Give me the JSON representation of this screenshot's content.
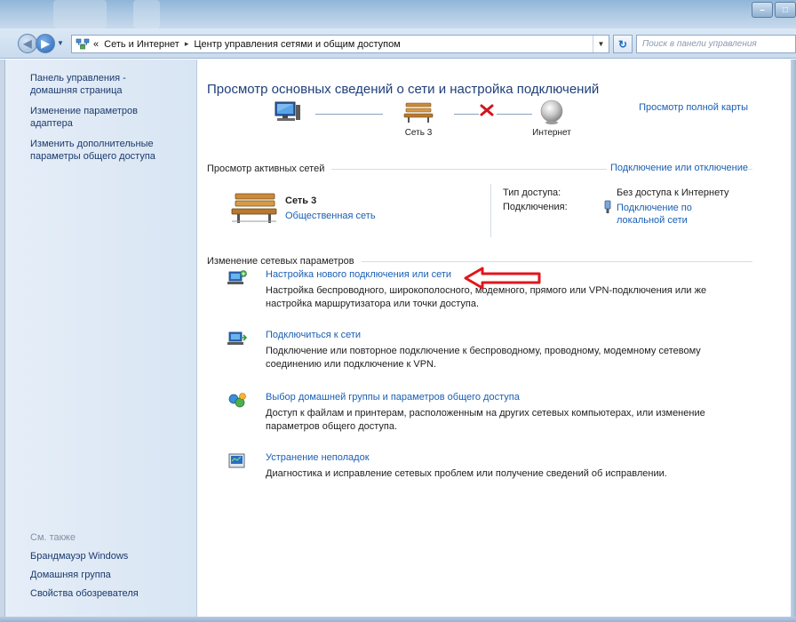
{
  "address": {
    "overflow_glyph": "«",
    "crumbs": [
      "Сеть и Интернет",
      "Центр управления сетями и общим доступом"
    ],
    "separator": "▸",
    "search_placeholder": "Поиск в панели управления"
  },
  "window_buttons": {
    "minimize": "–",
    "maximize": "□"
  },
  "sidebar": {
    "links": [
      "Панель управления - домашняя страница",
      "Изменение параметров адаптера",
      "Изменить дополнительные параметры общего доступа"
    ],
    "see_also_title": "См. также",
    "see_also": [
      "Брандмауэр Windows",
      "Домашняя группа",
      "Свойства обозревателя"
    ]
  },
  "main": {
    "title": "Просмотр основных сведений о сети и настройка подключений",
    "view_full_map": "Просмотр полной карты",
    "map": {
      "network_label": "Сеть  3",
      "internet_label": "Интернет"
    },
    "active_networks_heading": "Просмотр активных сетей",
    "connect_disconnect": "Подключение или отключение",
    "active_network": {
      "name": "Сеть  3",
      "type": "Общественная сеть",
      "access_type_label": "Тип доступа:",
      "access_type_value": "Без доступа к Интернету",
      "connections_label": "Подключения:",
      "connections_value": "Подключение по локальной сети"
    },
    "change_settings_heading": "Изменение сетевых параметров",
    "tasks": [
      {
        "link": "Настройка нового подключения или сети",
        "desc": "Настройка беспроводного, широкополосного, модемного, прямого или VPN-подключения или же настройка маршрутизатора или точки доступа.",
        "icon": "new-connection-icon"
      },
      {
        "link": "Подключиться к сети",
        "desc": "Подключение или повторное подключение к беспроводному, проводному, модемному сетевому соединению или подключение к VPN.",
        "icon": "connect-network-icon"
      },
      {
        "link": "Выбор домашней группы и параметров общего доступа",
        "desc": "Доступ к файлам и принтерам, расположенным на других сетевых компьютерах, или изменение параметров общего доступа.",
        "icon": "homegroup-icon"
      },
      {
        "link": "Устранение неполадок",
        "desc": "Диагностика и исправление сетевых проблем или получение сведений об исправлении.",
        "icon": "troubleshoot-icon"
      }
    ]
  },
  "colors": {
    "link": "#1a5fb4",
    "title": "#1f3f7a",
    "annotation_arrow": "#e0161c",
    "disconnected_x": "#d0161c"
  }
}
